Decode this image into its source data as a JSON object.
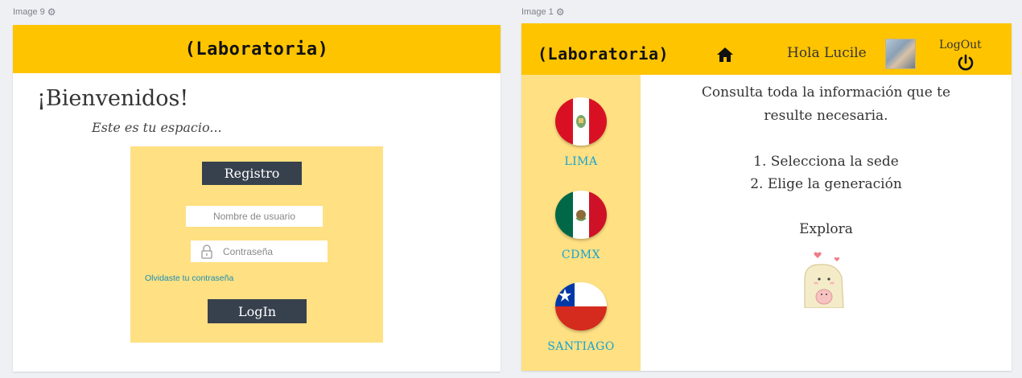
{
  "frames": {
    "left_label": "Image 9",
    "right_label": "Image 1"
  },
  "brand": {
    "logo": "(Laboratoria)",
    "yellow": "#ffc400",
    "light_yellow": "#ffe082",
    "dark_button": "#37404d",
    "link_blue": "#17a3d0"
  },
  "login_screen": {
    "welcome": "¡Bienvenidos!",
    "subtitle": "Este es tu espacio...",
    "register_button": "Registro",
    "username_placeholder": "Nombre de usuario",
    "password_placeholder": "Contraseña",
    "forgot_link": "Olvidaste tu contraseña",
    "login_button": "LogIn"
  },
  "dashboard": {
    "greeting": "Hola Lucile",
    "logout": "LogOut",
    "icons": [
      "home-icon",
      "power-icon",
      "lock-icon",
      "gear-icon"
    ],
    "sedes": [
      {
        "label": "LIMA",
        "flag": "peru-flag"
      },
      {
        "label": "CDMX",
        "flag": "mexico-flag"
      },
      {
        "label": "SANTIAGO",
        "flag": "chile-flag"
      }
    ],
    "info": {
      "line1": "Consulta toda la información que te",
      "line2": "resulte necesaria.",
      "step1": "1. Selecciona la sede",
      "step2": "2. Elige la generación",
      "explore": "Explora"
    }
  }
}
